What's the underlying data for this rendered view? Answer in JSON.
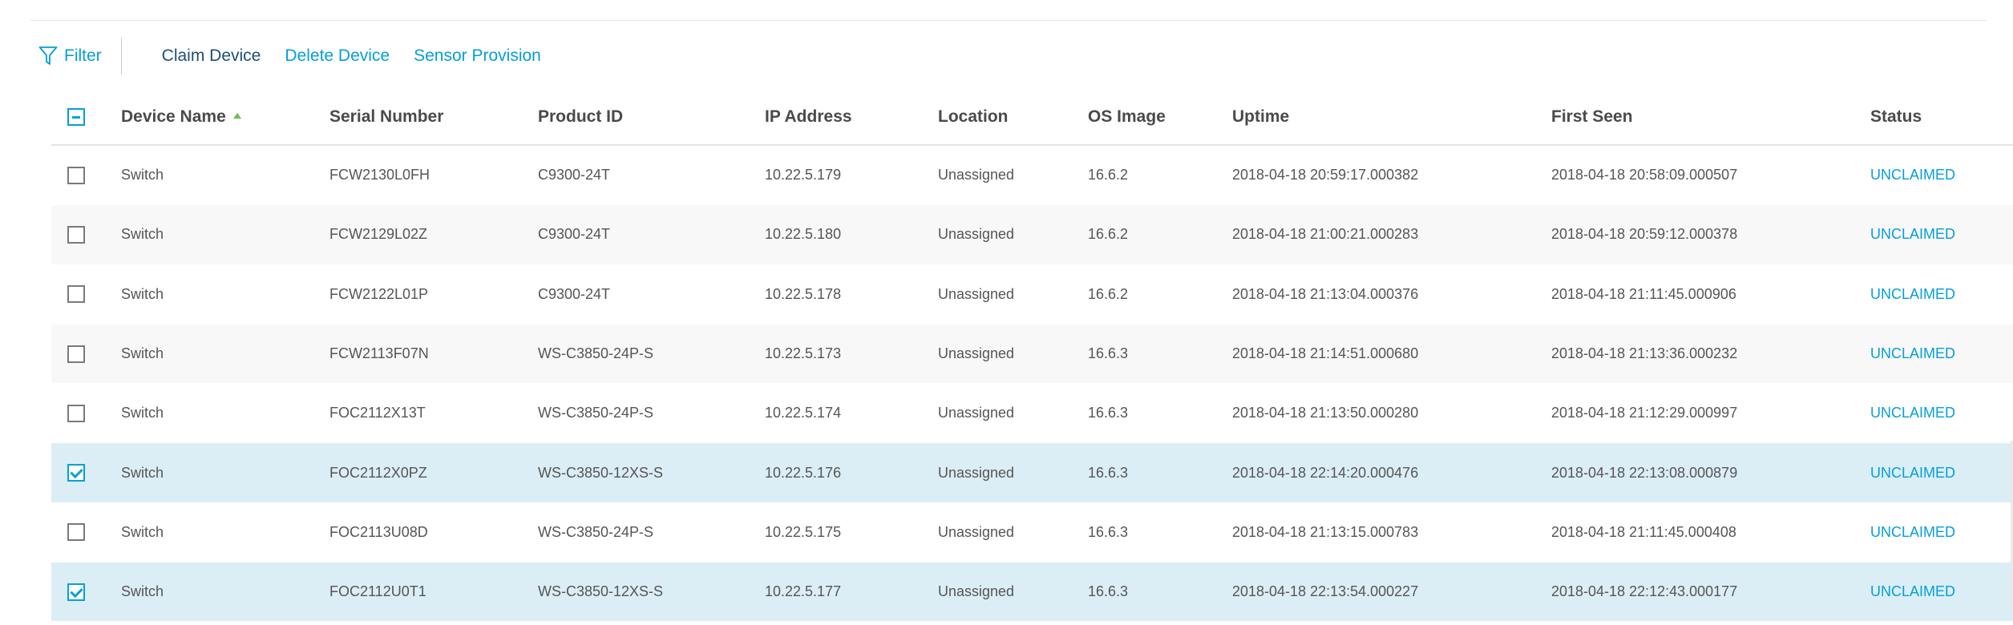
{
  "toolbar": {
    "filter_label": "Filter",
    "actions": [
      "Claim Device",
      "Delete Device",
      "Sensor Provision"
    ]
  },
  "columns": [
    "Device Name",
    "Serial Number",
    "Product ID",
    "IP Address",
    "Location",
    "OS Image",
    "Uptime",
    "First Seen",
    "Status"
  ],
  "sort": {
    "column": "Device Name",
    "direction": "ascending"
  },
  "select_all_state": "partial",
  "rows": [
    {
      "checked": false,
      "cells": [
        "Switch",
        "FCW2130L0FH",
        "C9300-24T",
        "10.22.5.179",
        "Unassigned",
        "16.6.2",
        "2018-04-18 20:59:17.000382",
        "2018-04-18 20:58:09.000507",
        "UNCLAIMED"
      ]
    },
    {
      "checked": false,
      "cells": [
        "Switch",
        "FCW2129L02Z",
        "C9300-24T",
        "10.22.5.180",
        "Unassigned",
        "16.6.2",
        "2018-04-18 21:00:21.000283",
        "2018-04-18 20:59:12.000378",
        "UNCLAIMED"
      ]
    },
    {
      "checked": false,
      "cells": [
        "Switch",
        "FCW2122L01P",
        "C9300-24T",
        "10.22.5.178",
        "Unassigned",
        "16.6.2",
        "2018-04-18 21:13:04.000376",
        "2018-04-18 21:11:45.000906",
        "UNCLAIMED"
      ]
    },
    {
      "checked": false,
      "cells": [
        "Switch",
        "FCW2113F07N",
        "WS-C3850-24P-S",
        "10.22.5.173",
        "Unassigned",
        "16.6.3",
        "2018-04-18 21:14:51.000680",
        "2018-04-18 21:13:36.000232",
        "UNCLAIMED"
      ]
    },
    {
      "checked": false,
      "cells": [
        "Switch",
        "FOC2112X13T",
        "WS-C3850-24P-S",
        "10.22.5.174",
        "Unassigned",
        "16.6.3",
        "2018-04-18 21:13:50.000280",
        "2018-04-18 21:12:29.000997",
        "UNCLAIMED"
      ]
    },
    {
      "checked": true,
      "cells": [
        "Switch",
        "FOC2112X0PZ",
        "WS-C3850-12XS-S",
        "10.22.5.176",
        "Unassigned",
        "16.6.3",
        "2018-04-18 22:14:20.000476",
        "2018-04-18 22:13:08.000879",
        "UNCLAIMED"
      ]
    },
    {
      "checked": false,
      "cells": [
        "Switch",
        "FOC2113U08D",
        "WS-C3850-24P-S",
        "10.22.5.175",
        "Unassigned",
        "16.6.3",
        "2018-04-18 21:13:15.000783",
        "2018-04-18 21:11:45.000408",
        "UNCLAIMED"
      ]
    },
    {
      "checked": true,
      "cells": [
        "Switch",
        "FOC2112U0T1",
        "WS-C3850-12XS-S",
        "10.22.5.177",
        "Unassigned",
        "16.6.3",
        "2018-04-18 22:13:54.000227",
        "2018-04-18 22:12:43.000177",
        "UNCLAIMED"
      ]
    }
  ],
  "colors": {
    "accent": "#049fd9",
    "primary_action": "#1f4f73",
    "selected_row": "#dbeef6",
    "sort_indicator": "#6cc04a"
  }
}
